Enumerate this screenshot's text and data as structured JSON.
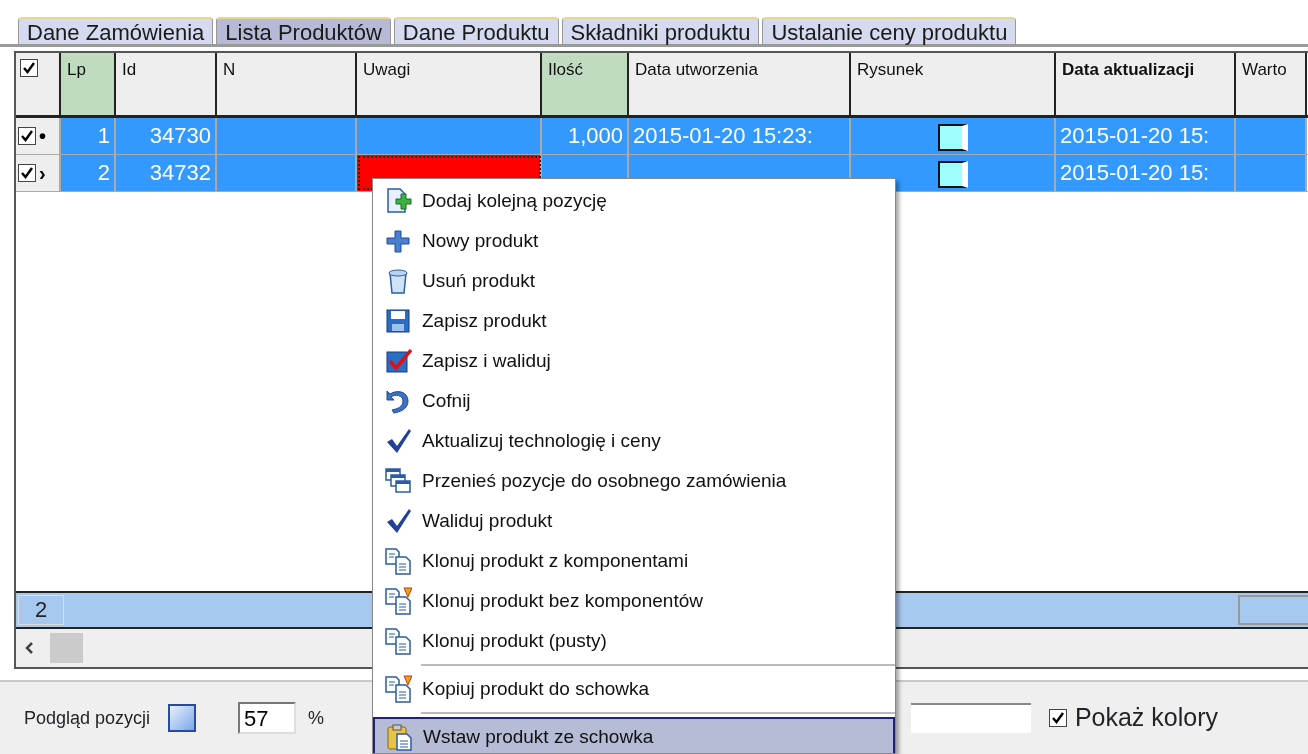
{
  "tabs": [
    {
      "label": "Dane Zamówienia",
      "selected": false
    },
    {
      "label": "Lista Produktów",
      "selected": true
    },
    {
      "label": "Dane Produktu",
      "selected": false
    },
    {
      "label": "Składniki produktu",
      "selected": false
    },
    {
      "label": "Ustalanie ceny produktu",
      "selected": false
    }
  ],
  "grid": {
    "select_all_checked": true,
    "columns": [
      {
        "label": "Lp",
        "highlighted": true,
        "bold": false
      },
      {
        "label": "Id",
        "highlighted": false,
        "bold": false
      },
      {
        "label": "N",
        "highlighted": false,
        "bold": false
      },
      {
        "label": "Uwagi",
        "highlighted": false,
        "bold": false
      },
      {
        "label": "Ilość",
        "highlighted": true,
        "bold": false
      },
      {
        "label": "Data utworzenia",
        "highlighted": false,
        "bold": false
      },
      {
        "label": "Rysunek",
        "highlighted": false,
        "bold": false
      },
      {
        "label": "Data aktualizacji",
        "highlighted": false,
        "bold": true
      },
      {
        "label": "Warto",
        "highlighted": false,
        "bold": false
      }
    ],
    "rows": [
      {
        "checked": true,
        "indicator": "•",
        "selected": true,
        "marked_cell": false,
        "cells": [
          "1",
          "34730",
          "",
          "",
          "1,000",
          "2015-01-20 15:23:",
          "",
          "2015-01-20 15:",
          ""
        ],
        "drawing": true
      },
      {
        "checked": true,
        "indicator": "›",
        "selected": true,
        "marked_cell": true,
        "cells": [
          "2",
          "34732",
          "",
          "",
          "",
          "",
          "",
          "2015-01-20 15:",
          ""
        ],
        "drawing": true
      }
    ],
    "footer": {
      "count": "2"
    }
  },
  "bottom_panel": {
    "preview_label": "Podgląd pozycji",
    "zoom_value": "57",
    "zoom_unit": "%",
    "show_colors": {
      "label": "Pokaż kolory",
      "checked": true
    }
  },
  "context_menu": [
    {
      "kind": "item",
      "label": "Dodaj kolejną pozycję",
      "selected": false
    },
    {
      "kind": "item",
      "label": "Nowy produkt",
      "selected": false
    },
    {
      "kind": "item",
      "label": "Usuń produkt",
      "selected": false
    },
    {
      "kind": "item",
      "label": "Zapisz produkt",
      "selected": false
    },
    {
      "kind": "item",
      "label": "Zapisz i waliduj",
      "selected": false
    },
    {
      "kind": "item",
      "label": "Cofnij",
      "selected": false
    },
    {
      "kind": "item",
      "label": "Aktualizuj technologię i ceny",
      "selected": false
    },
    {
      "kind": "item",
      "label": "Przenieś pozycje do osobnego zamówienia",
      "selected": false
    },
    {
      "kind": "item",
      "label": "Waliduj produkt",
      "selected": false
    },
    {
      "kind": "item",
      "label": "Klonuj produkt z komponentami",
      "selected": false
    },
    {
      "kind": "item",
      "label": "Klonuj produkt bez komponentów",
      "selected": false
    },
    {
      "kind": "item",
      "label": "Klonuj produkt (pusty)",
      "selected": false
    },
    {
      "kind": "separator"
    },
    {
      "kind": "item",
      "label": "Kopiuj produkt do schowka",
      "selected": false
    },
    {
      "kind": "separator"
    },
    {
      "kind": "item",
      "label": "Wstaw produkt ze schowka",
      "selected": true
    }
  ]
}
